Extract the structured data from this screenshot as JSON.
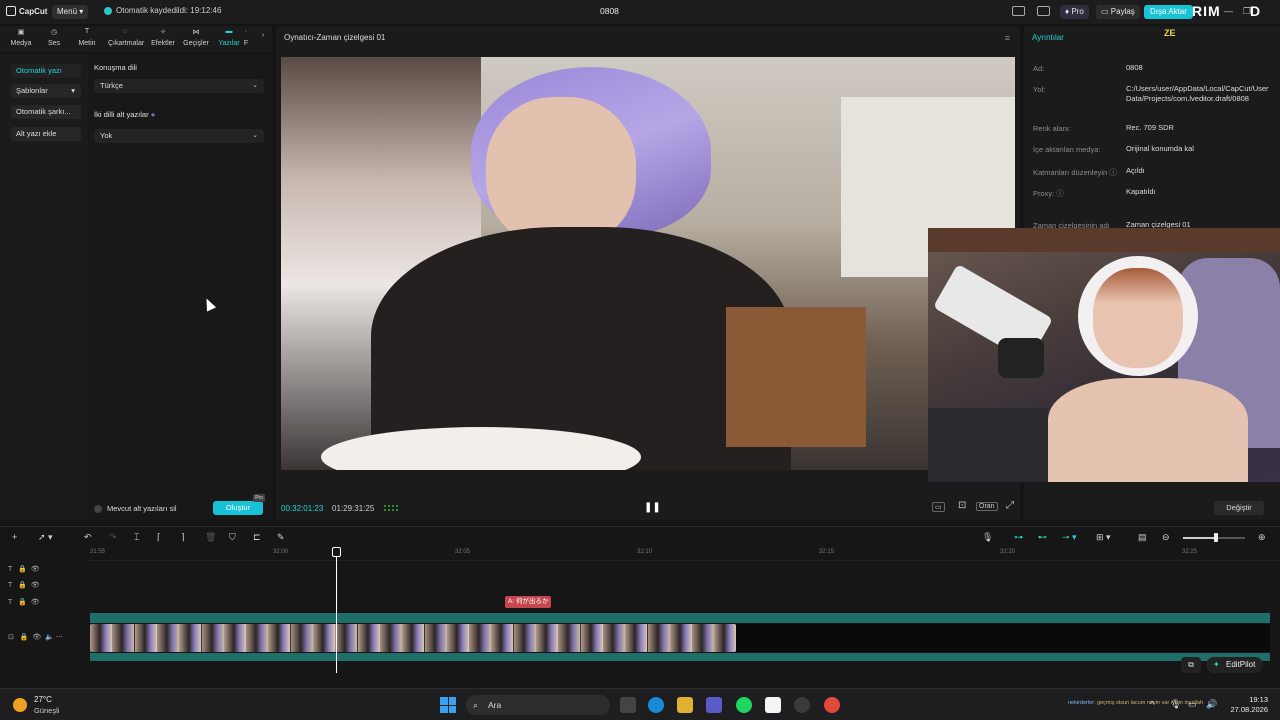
{
  "titlebar": {
    "app_name": "CapCut",
    "menu_label": "Menü",
    "autosave_text": "Otomatik kaydedildi: 19:12:46",
    "project_title": "0808",
    "pro_label": "Pro",
    "share_label": "Paylaş",
    "export_label": "Dışa Aktar",
    "overlay_brand": "RIM",
    "overlay_mark": "D"
  },
  "tools": [
    {
      "label": "Medya",
      "icon": "media-icon"
    },
    {
      "label": "Ses",
      "icon": "audio-icon"
    },
    {
      "label": "Metin",
      "icon": "text-icon"
    },
    {
      "label": "Çıkartmalar",
      "icon": "sticker-icon"
    },
    {
      "label": "Efektler",
      "icon": "effects-icon"
    },
    {
      "label": "Geçişler",
      "icon": "transitions-icon"
    },
    {
      "label": "Yazılar",
      "icon": "captions-icon"
    },
    {
      "label": "F",
      "icon": "filters-icon"
    }
  ],
  "left_nav": {
    "items": [
      {
        "label": "Otomatik yazı"
      },
      {
        "label": "Şablonlar"
      },
      {
        "label": "Otomatik şarkı..."
      },
      {
        "label": "Alt yazı ekle"
      }
    ]
  },
  "captions_panel": {
    "language_label": "Konuşma dili",
    "language_value": "Türkçe",
    "bilingual_label": "İki dilli alt yazılar",
    "bilingual_value": "Yok",
    "delete_existing_label": "Mevcut alt yazıları sil",
    "create_label": "Oluştur",
    "create_badge": "Pro"
  },
  "player": {
    "title": "Oynatıcı-Zaman çizelgesi 01",
    "current_time": "00:32:01:23",
    "duration": "01:29:31:25",
    "fit_label": "Oran"
  },
  "details": {
    "title": "Ayrıntılar",
    "rows": [
      {
        "label": "Ad:",
        "value": "0808"
      },
      {
        "label": "Yol:",
        "value": "C:/Users/user/AppData/Local/CapCut/User Data/Projects/com.lveditor.draft/0808"
      },
      {
        "label": "Renk alanı:",
        "value": "Rec. 709 SDR"
      },
      {
        "label": "İçe aktarılan medya:",
        "value": "Orijinal konumda kal"
      },
      {
        "label": "Katmanları düzenleyin",
        "value": "Açıldı"
      },
      {
        "label": "Proxy:",
        "value": "Kapatıldı"
      },
      {
        "label": "Zaman çizelgesinin adı",
        "value": "Zaman çizelgesi 01"
      }
    ],
    "change_label": "Değiştir",
    "overlay_logo": "ZE"
  },
  "timeline": {
    "ruler_labels": [
      "31:55",
      "32:00",
      "32:05",
      "32:10",
      "32:15",
      "32:20",
      "32:25"
    ],
    "subtitle_clip_text": "何が出るか",
    "editpilot_label": "EditPilot"
  },
  "taskbar": {
    "temperature": "27°C",
    "weather": "Güneşli",
    "search_placeholder": "Ara",
    "ticker_user": "nekirderler",
    "ticker_text": ": geçmiş olsun lacum neyin var iyisin inşallah",
    "time": "19:13",
    "date": "27.08.2026"
  },
  "colors": {
    "accent": "#2bd0d6",
    "export": "#19c2d6",
    "subtitle_clip": "#c4474f",
    "audio_track": "#1f6e6a"
  }
}
